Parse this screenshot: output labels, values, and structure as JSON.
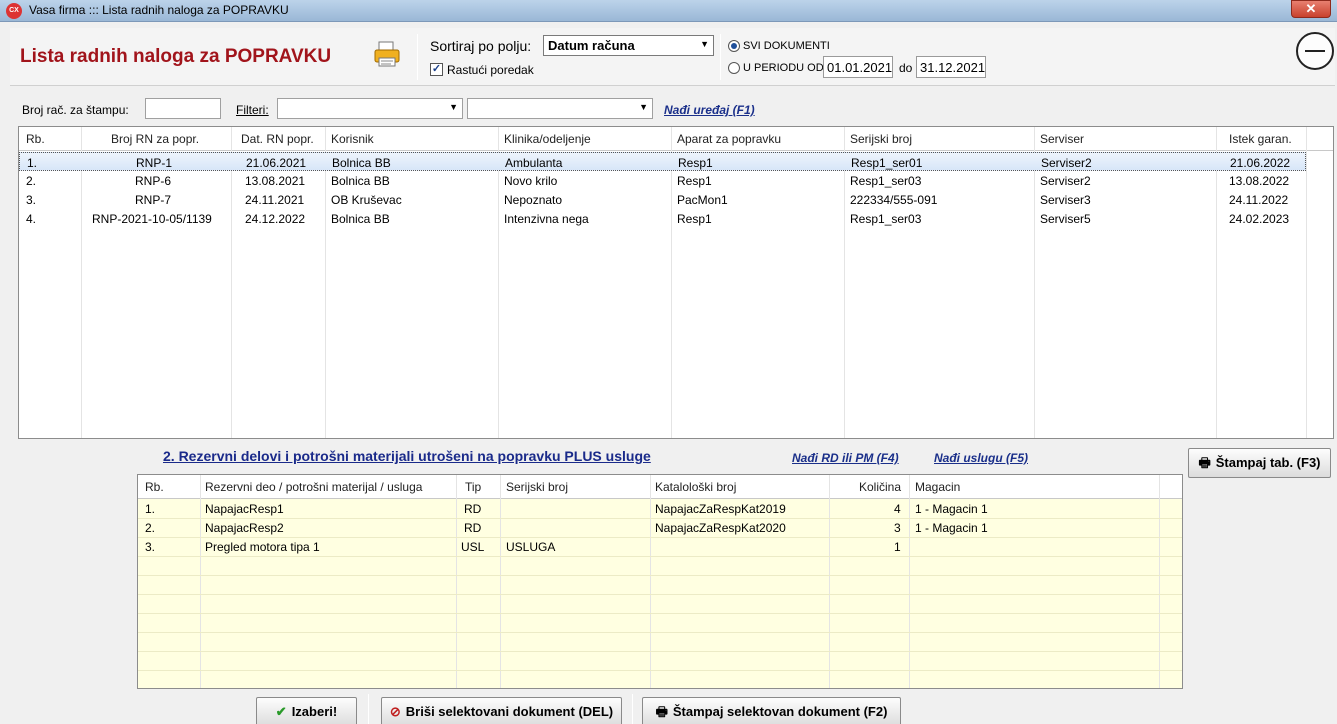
{
  "window": {
    "title": "Vasa firma ::: Lista radnih naloga za POPRAVKU",
    "app_icon": "CX",
    "close": "✕"
  },
  "header": {
    "title": "Lista radnih naloga za POPRAVKU",
    "sort_label": "Sortiraj po polju:",
    "sort_value": "Datum računa",
    "ascending_label": "Rastući poredak",
    "ascending_checked": true,
    "radio_all_label": "SVI DOKUMENTI",
    "radio_period_label": "U PERIODU OD:",
    "date_from": "01.01.2021",
    "date_to_label": "do",
    "date_to": "31.12.2021"
  },
  "filters": {
    "print_number_label": "Broj rač. za štampu:",
    "filters_label": "Filteri:",
    "find_device_link": "Nađi uređaj (F1)"
  },
  "orders": {
    "columns": [
      "Rb.",
      "Broj RN za popr.",
      "Dat. RN popr.",
      "Korisnik",
      "Klinika/odeljenje",
      "Aparat za popravku",
      "Serijski broj",
      "Serviser",
      "Istek garan."
    ],
    "rows": [
      [
        "1.",
        "RNP-1",
        "21.06.2021",
        "Bolnica BB",
        "Ambulanta",
        "Resp1",
        "Resp1_ser01",
        "Serviser2",
        "21.06.2022"
      ],
      [
        "2.",
        "RNP-6",
        "13.08.2021",
        "Bolnica BB",
        "Novo krilo",
        "Resp1",
        "Resp1_ser03",
        "Serviser2",
        "13.08.2022"
      ],
      [
        "3.",
        "RNP-7",
        "24.11.2021",
        "OB Kruševac",
        "Nepoznato",
        "PacMon1",
        "222334/555-091",
        "Serviser3",
        "24.11.2022"
      ],
      [
        "4.",
        "RNP-2021-10-05/1139",
        "24.12.2022",
        "Bolnica BB",
        "Intenzivna nega",
        "Resp1",
        "Resp1_ser03",
        "Serviser5",
        "24.02.2023"
      ]
    ]
  },
  "parts": {
    "title": "2.  Rezervni delovi i potrošni materijali utrošeni na popravku PLUS usluge",
    "find_rd_link": "Nađi RD ili PM (F4)",
    "find_service_link": "Nađi uslugu (F5)",
    "print_tab_button": "Štampaj tab. (F3)",
    "columns": [
      "Rb.",
      "Rezervni deo / potrošni materijal / usluga",
      "Tip",
      "Serijski broj",
      "Katalološki broj",
      "Količina",
      "Magacin"
    ],
    "rows": [
      [
        "1.",
        "NapajacResp1",
        "RD",
        "",
        "NapajacZaRespKat2019",
        "4",
        "1 - Magacin 1"
      ],
      [
        "2.",
        "NapajacResp2",
        "RD",
        "",
        "NapajacZaRespKat2020",
        "3",
        "1 - Magacin 1"
      ],
      [
        "3.",
        "Pregled motora tipa 1",
        "USL",
        "USLUGA",
        "",
        "1",
        ""
      ]
    ]
  },
  "footer": {
    "select_button": "Izaberi!",
    "delete_button": "Briši selektovani dokument (DEL)",
    "print_button": "Štampaj selektovan dokument (F2)"
  },
  "colors": {
    "title_red": "#a1141b",
    "link_blue": "#1a2f8a",
    "grid2_bg": "#ffffe1"
  },
  "icons": [
    "printer-icon",
    "power-icon",
    "checkmark-icon",
    "delete-icon"
  ]
}
